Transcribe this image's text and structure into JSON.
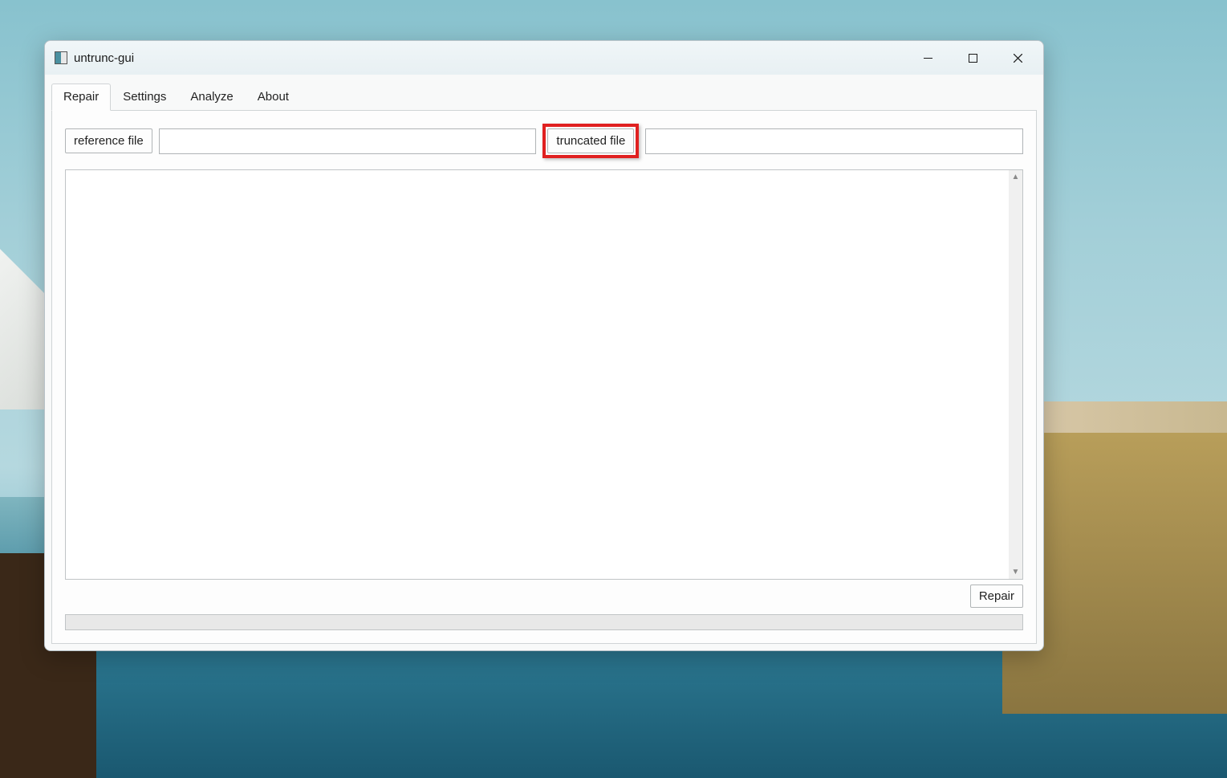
{
  "window": {
    "title": "untrunc-gui"
  },
  "tabs": [
    {
      "label": "Repair",
      "active": true
    },
    {
      "label": "Settings",
      "active": false
    },
    {
      "label": "Analyze",
      "active": false
    },
    {
      "label": "About",
      "active": false
    }
  ],
  "repair_tab": {
    "reference_button": "reference file",
    "reference_value": "",
    "truncated_button": "truncated file",
    "truncated_value": "",
    "log_text": "",
    "repair_button": "Repair"
  },
  "highlight": {
    "target": "truncated-file-button"
  }
}
